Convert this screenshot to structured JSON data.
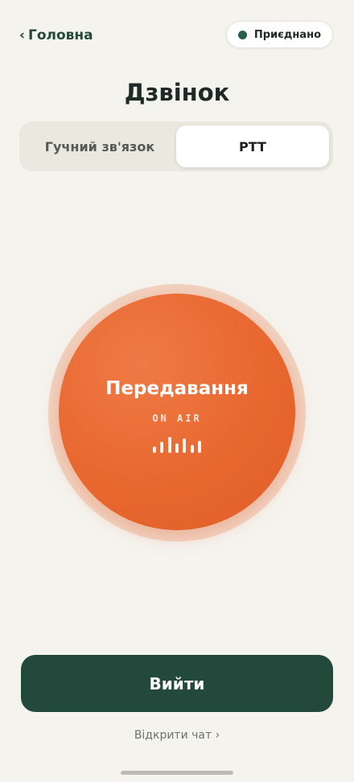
{
  "header": {
    "back_chevron": "‹",
    "back_label": "Головна",
    "status_label": "Приєднано",
    "status_color": "#2b5f4d"
  },
  "title": "Дзвінок",
  "mode_tabs": {
    "items": [
      {
        "label": "Гучний зв'язок",
        "active": false
      },
      {
        "label": "PTT",
        "active": true
      }
    ]
  },
  "ptt": {
    "label": "Передавання",
    "sub_label": "ON AIR",
    "accent_color": "#e8672f",
    "wave_icon": "waveform-icon"
  },
  "actions": {
    "exit_label": "Вийти",
    "open_chat_label": "Відкрити чат ›"
  },
  "colors": {
    "background": "#f5f3ee",
    "primary": "#23493d",
    "accent": "#e8672f"
  }
}
